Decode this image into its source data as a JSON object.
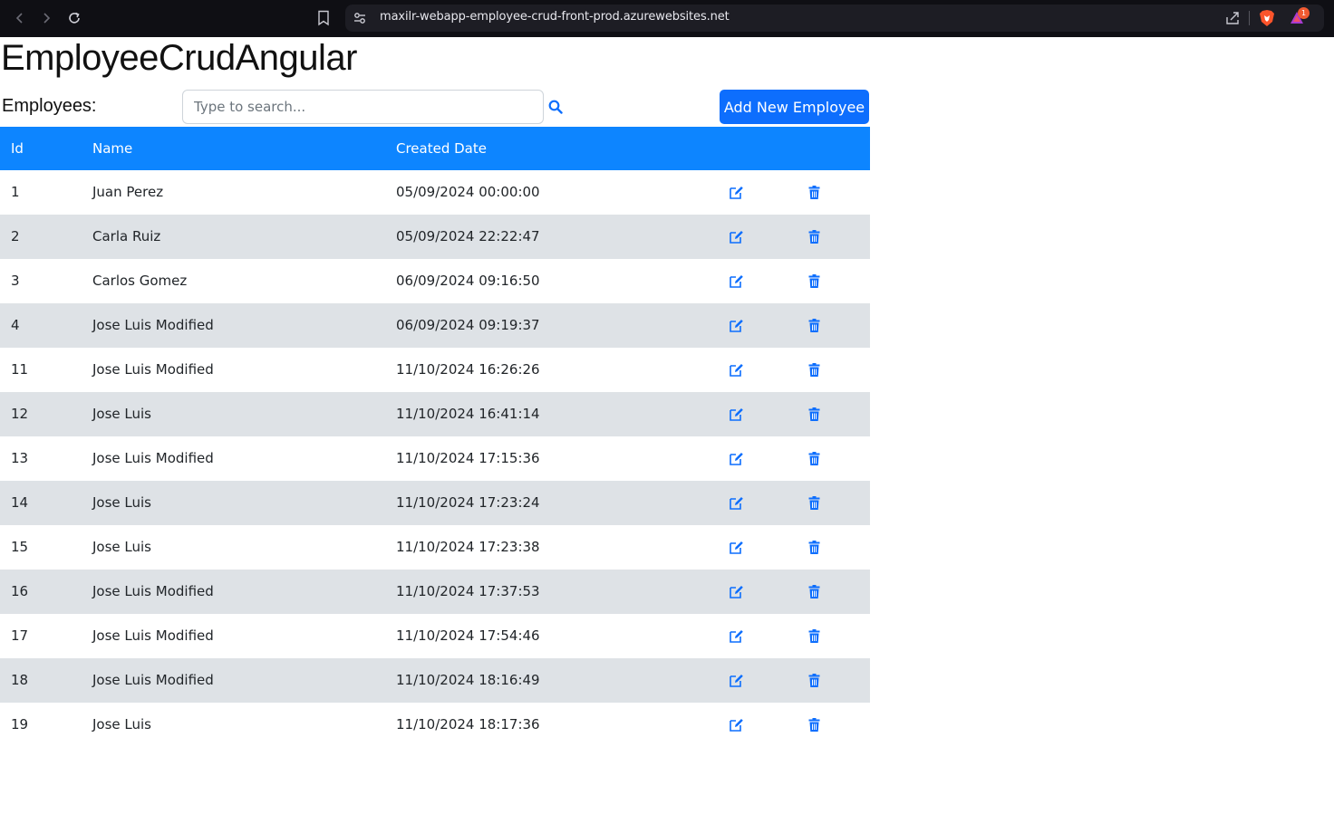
{
  "browser": {
    "url": "maxilr-webapp-employee-crud-front-prod.azurewebsites.net",
    "notification_count": "1"
  },
  "app": {
    "title": "EmployeeCrudAngular",
    "employees_label": "Employees:",
    "search_placeholder": "Type to search...",
    "search_value": "",
    "add_button_label": "Add New Employee",
    "accent_color": "#0d6efd",
    "header_color": "#0d85ff",
    "stripe_color": "#dee2e6"
  },
  "table": {
    "headers": [
      "Id",
      "Name",
      "Created Date"
    ],
    "rows": [
      {
        "id": "1",
        "name": "Juan Perez",
        "created": "05/09/2024 00:00:00"
      },
      {
        "id": "2",
        "name": "Carla Ruiz",
        "created": "05/09/2024 22:22:47"
      },
      {
        "id": "3",
        "name": "Carlos Gomez",
        "created": "06/09/2024 09:16:50"
      },
      {
        "id": "4",
        "name": "Jose Luis Modified",
        "created": "06/09/2024 09:19:37"
      },
      {
        "id": "11",
        "name": "Jose Luis Modified",
        "created": "11/10/2024 16:26:26"
      },
      {
        "id": "12",
        "name": "Jose Luis",
        "created": "11/10/2024 16:41:14"
      },
      {
        "id": "13",
        "name": "Jose Luis Modified",
        "created": "11/10/2024 17:15:36"
      },
      {
        "id": "14",
        "name": "Jose Luis",
        "created": "11/10/2024 17:23:24"
      },
      {
        "id": "15",
        "name": "Jose Luis",
        "created": "11/10/2024 17:23:38"
      },
      {
        "id": "16",
        "name": "Jose Luis Modified",
        "created": "11/10/2024 17:37:53"
      },
      {
        "id": "17",
        "name": "Jose Luis Modified",
        "created": "11/10/2024 17:54:46"
      },
      {
        "id": "18",
        "name": "Jose Luis Modified",
        "created": "11/10/2024 18:16:49"
      },
      {
        "id": "19",
        "name": "Jose Luis",
        "created": "11/10/2024 18:17:36"
      }
    ],
    "row_icons": [
      "edit-icon",
      "trash-icon"
    ]
  }
}
